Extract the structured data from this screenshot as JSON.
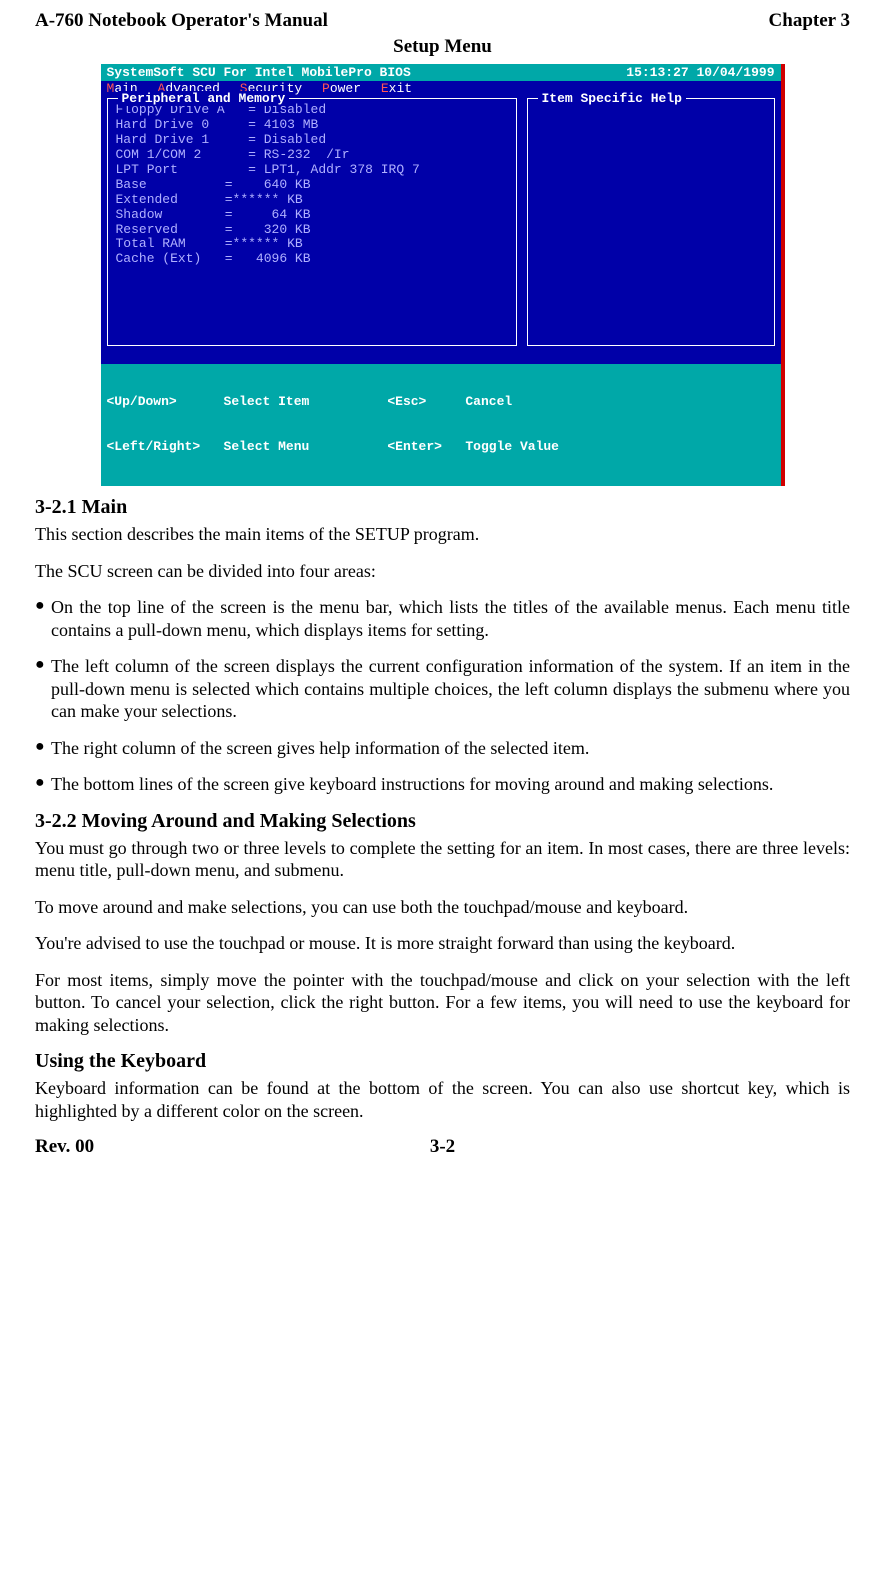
{
  "header": {
    "left": "A-760 Notebook Operator's Manual",
    "right": "Chapter 3"
  },
  "figure_title": "Setup Menu",
  "bios": {
    "topbar_left": "SystemSoft SCU For Intel MobilePro BIOS",
    "topbar_right": "15:13:27  10/04/1999",
    "menu": {
      "main_hl": "M",
      "main": "ain",
      "adv_hl": "A",
      "adv": "dvanced",
      "sec_hl": "S",
      "sec": "ecurity",
      "pow_hl": "P",
      "pow": "ower",
      "exit_hl": "E",
      "exit": "xit"
    },
    "left_title": "Peripheral and Memory",
    "right_title": "Item Specific Help",
    "rows": {
      "r0": "Floppy Drive A   = Disabled",
      "r1": "Hard Drive 0     = 4103 MB",
      "r2": "Hard Drive 1     = Disabled",
      "r3": "COM 1/COM 2      = RS-232  /Ir",
      "r4": "LPT Port         = LPT1, Addr 378 IRQ 7",
      "r5": "",
      "r6": "Base          =    640 KB",
      "r7": "Extended      =****** KB",
      "r8": "Shadow        =     64 KB",
      "r9": "Reserved      =    320 KB",
      "r10": "Total RAM     =****** KB",
      "r11": "Cache (Ext)   =   4096 KB"
    },
    "bottom1": "<Up/Down>      Select Item          <Esc>     Cancel",
    "bottom2": "<Left/Right>   Select Menu          <Enter>   Toggle Value"
  },
  "s321_title": "3-2.1  Main",
  "s321_p1": "This section describes the main items of the SETUP program.",
  "s321_p2": "The SCU screen can be divided into four areas:",
  "s321_b1": "On the top line of the screen is the menu bar, which lists the titles of the available menus. Each menu title contains a pull-down menu, which displays items for setting.",
  "s321_b2": "The left column of the screen displays the current configuration information of the system. If an item in the pull-down menu is selected which contains multiple choices, the left column displays the submenu where you can make your selections.",
  "s321_b3": "The right column of the screen gives help information of the selected item.",
  "s321_b4": "The bottom lines of the screen give keyboard instructions for moving around and making selections.",
  "s322_title": "3-2.2   Moving Around and Making Selections",
  "s322_p1": "You must go through two or three levels to complete the setting for an item. In most cases, there are three levels: menu title, pull-down menu, and submenu.",
  "s322_p2": "To move around and make selections, you can use both the touchpad/mouse and keyboard.",
  "s322_p3": "You're advised to use the touchpad or mouse. It is more straight forward than using the keyboard.",
  "s322_p4": "For most items, simply move the pointer with the touchpad/mouse and click on your selection with the left button. To cancel your selection, click the right button. For a few items, you will need to use the keyboard for making selections.",
  "uk_title": "Using the Keyboard",
  "uk_p1": "Keyboard information can be found at the bottom of the screen. You can also use shortcut key, which is highlighted by a different color on the screen.",
  "footer": {
    "left": "Rev. 00",
    "page": "3-2"
  }
}
